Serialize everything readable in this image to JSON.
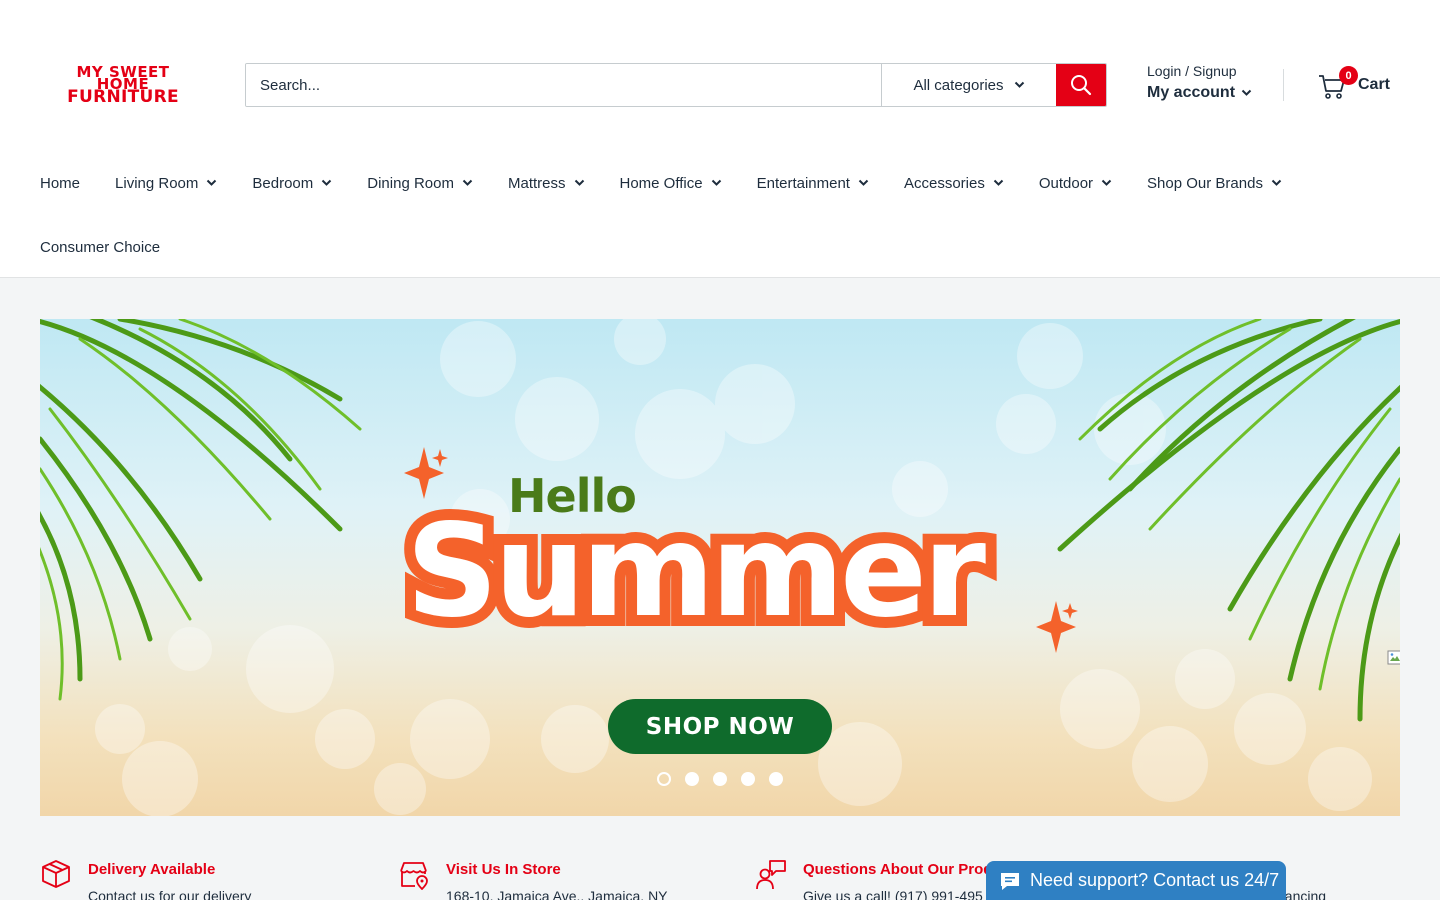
{
  "brand": {
    "logo_lines": [
      "MY SWEET",
      "HOME",
      "FURNITURE"
    ],
    "accent_color": "#e40015"
  },
  "search": {
    "placeholder": "Search...",
    "category_label": "All categories",
    "button_icon": "search-icon"
  },
  "account": {
    "login_label": "Login / Signup",
    "my_account_label": "My account"
  },
  "cart": {
    "count": "0",
    "label": "Cart"
  },
  "nav": {
    "items": [
      {
        "label": "Home",
        "has_dropdown": false
      },
      {
        "label": "Living Room",
        "has_dropdown": true
      },
      {
        "label": "Bedroom",
        "has_dropdown": true
      },
      {
        "label": "Dining Room",
        "has_dropdown": true
      },
      {
        "label": "Mattress",
        "has_dropdown": true
      },
      {
        "label": "Home Office",
        "has_dropdown": true
      },
      {
        "label": "Entertainment",
        "has_dropdown": true
      },
      {
        "label": "Accessories",
        "has_dropdown": true
      },
      {
        "label": "Outdoor",
        "has_dropdown": true
      },
      {
        "label": "Shop Our Brands",
        "has_dropdown": true
      }
    ],
    "second_row": [
      {
        "label": "Consumer Choice",
        "has_dropdown": false
      }
    ]
  },
  "hero": {
    "hello": "Hello",
    "summer": "Summer",
    "cta": "SHOP NOW",
    "slide_count": 5,
    "active_slide": 1
  },
  "features": [
    {
      "icon": "delivery-box-icon",
      "title": "Delivery Available",
      "desc": "Contact us for our delivery"
    },
    {
      "icon": "store-location-icon",
      "title": "Visit Us In Store",
      "desc": "168-10, Jamaica Ave., Jamaica, NY"
    },
    {
      "icon": "customer-questions-icon",
      "title": "Questions About Our Prod",
      "desc": "Give us a call! (917) 991-495"
    },
    {
      "icon": "financing-icon",
      "title": "le",
      "desc": "financing"
    }
  ],
  "support": {
    "icon": "chat-bubble-icon",
    "label": "Need support? Contact us 24/7",
    "color": "#2f80c3"
  }
}
